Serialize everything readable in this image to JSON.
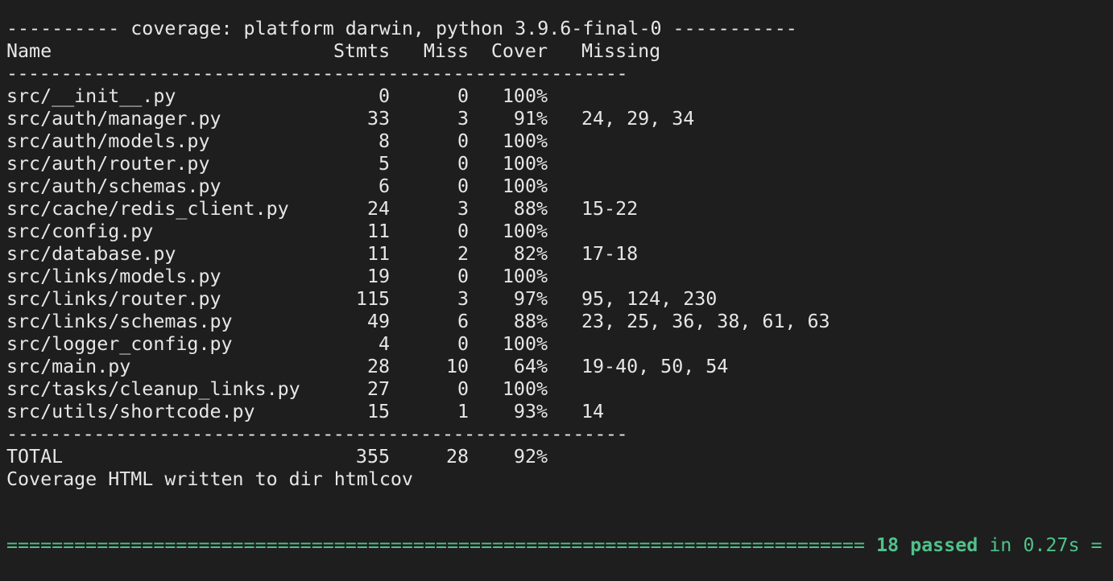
{
  "header_line": "---------- coverage: platform darwin, python 3.9.6-final-0 -----------",
  "columns": {
    "name": "Name",
    "stmts": "Stmts",
    "miss": "Miss",
    "cover": "Cover",
    "missing": "Missing"
  },
  "separator": "---------------------------------------------------------",
  "rows": [
    {
      "name": "src/__init__.py",
      "stmts": "0",
      "miss": "0",
      "cover": "100%",
      "missing": ""
    },
    {
      "name": "src/auth/manager.py",
      "stmts": "33",
      "miss": "3",
      "cover": "91%",
      "missing": "24, 29, 34"
    },
    {
      "name": "src/auth/models.py",
      "stmts": "8",
      "miss": "0",
      "cover": "100%",
      "missing": ""
    },
    {
      "name": "src/auth/router.py",
      "stmts": "5",
      "miss": "0",
      "cover": "100%",
      "missing": ""
    },
    {
      "name": "src/auth/schemas.py",
      "stmts": "6",
      "miss": "0",
      "cover": "100%",
      "missing": ""
    },
    {
      "name": "src/cache/redis_client.py",
      "stmts": "24",
      "miss": "3",
      "cover": "88%",
      "missing": "15-22"
    },
    {
      "name": "src/config.py",
      "stmts": "11",
      "miss": "0",
      "cover": "100%",
      "missing": ""
    },
    {
      "name": "src/database.py",
      "stmts": "11",
      "miss": "2",
      "cover": "82%",
      "missing": "17-18"
    },
    {
      "name": "src/links/models.py",
      "stmts": "19",
      "miss": "0",
      "cover": "100%",
      "missing": ""
    },
    {
      "name": "src/links/router.py",
      "stmts": "115",
      "miss": "3",
      "cover": "97%",
      "missing": "95, 124, 230"
    },
    {
      "name": "src/links/schemas.py",
      "stmts": "49",
      "miss": "6",
      "cover": "88%",
      "missing": "23, 25, 36, 38, 61, 63"
    },
    {
      "name": "src/logger_config.py",
      "stmts": "4",
      "miss": "0",
      "cover": "100%",
      "missing": ""
    },
    {
      "name": "src/main.py",
      "stmts": "28",
      "miss": "10",
      "cover": "64%",
      "missing": "19-40, 50, 54"
    },
    {
      "name": "src/tasks/cleanup_links.py",
      "stmts": "27",
      "miss": "0",
      "cover": "100%",
      "missing": ""
    },
    {
      "name": "src/utils/shortcode.py",
      "stmts": "15",
      "miss": "1",
      "cover": "93%",
      "missing": "14"
    }
  ],
  "total": {
    "name": "TOTAL",
    "stmts": "355",
    "miss": "28",
    "cover": "92%"
  },
  "html_note": "Coverage HTML written to dir htmlcov",
  "footer": {
    "rule_left": "============================================================================",
    "passed": "18 passed",
    "time": " in 0.27s ="
  },
  "colors": {
    "background": "#1e1e1e",
    "text": "#e6e6e6",
    "success": "#4fc28a"
  }
}
